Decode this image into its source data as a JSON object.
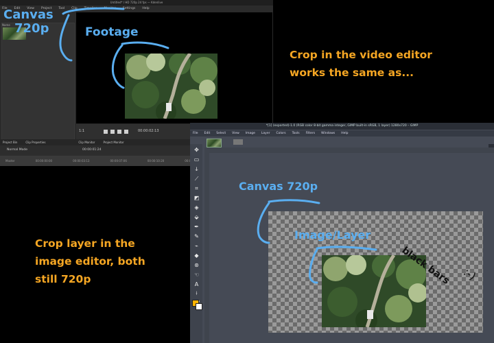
{
  "video_editor": {
    "title": "Untitled* / HD 720p 24 fps — Kdenlive",
    "menu": [
      "File",
      "Edit",
      "View",
      "Project",
      "Tool",
      "Clip",
      "Timeline",
      "Monitor",
      "Settings",
      "Help"
    ],
    "bin_header": "Name",
    "tabs": [
      "Project Bin",
      "Clip Properties",
      "Clip Monitor",
      "Project Monitor"
    ],
    "timecode_left": "00:00:01:24",
    "timecode_right": "00:00:02:13",
    "mode": "Normal Mode",
    "track_label": "Master",
    "timeline_ticks": [
      "00:00:00:00",
      "00:00:03:13",
      "00:00:07:06",
      "00:00:10:20",
      "00:00:14:13",
      "00:00:18:12"
    ],
    "zoom": "1:1"
  },
  "image_editor": {
    "title": "*[1] (exported)-1.0 (RGB color 8-bit gamma integer, GIMP built-in sRGB, 1 layer) 1280x720 – GIMP",
    "menu": [
      "File",
      "Edit",
      "Select",
      "View",
      "Image",
      "Layer",
      "Colors",
      "Tools",
      "Filters",
      "Windows",
      "Help"
    ],
    "tools": [
      "move-icon",
      "rect-select-icon",
      "lasso-icon",
      "fuzzy-select-icon",
      "crop-icon",
      "transform-icon",
      "warp-icon",
      "bucket-icon",
      "text-path-icon",
      "pencil-icon",
      "brush-icon",
      "eraser-icon",
      "clone-icon",
      "smudge-icon",
      "dodge-icon",
      "text-tool-icon",
      "color-picker-icon",
      "zoom-icon"
    ],
    "fg_color": "#ffb400",
    "bg_color": "#ffffff",
    "text_tool_glyph": "A"
  },
  "annotations": {
    "canvas_video_line1": "Canvas",
    "canvas_video_line2": "720p",
    "footage": "Footage",
    "right_line1": "Crop in the video editor",
    "right_line2": "works the same as...",
    "canvas_image": "Canvas 720p",
    "image_layer": "Image/Layer",
    "left_line1": "Crop layer  in the",
    "left_line2": "image editor, both",
    "left_line3": "still 720p",
    "black_bars": "black bars",
    "smile": ":-)"
  },
  "colors": {
    "annotation_blue": "#5aaef0",
    "annotation_orange": "#f5a623"
  }
}
